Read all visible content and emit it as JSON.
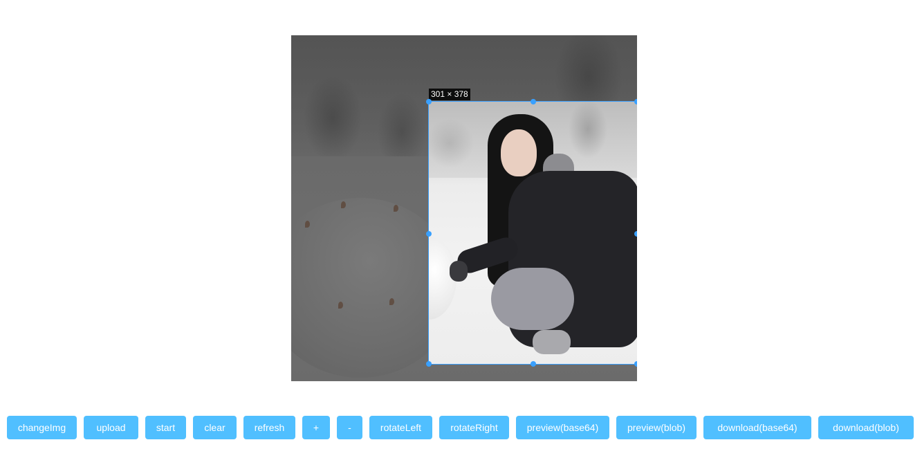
{
  "cropper": {
    "size_label": "301 × 378",
    "accent_color": "#39a0ff"
  },
  "toolbar": {
    "button_color": "#50bfff",
    "buttons": [
      {
        "label": "changeImg"
      },
      {
        "label": "upload"
      },
      {
        "label": "start"
      },
      {
        "label": "clear"
      },
      {
        "label": "refresh"
      },
      {
        "label": "+"
      },
      {
        "label": "-"
      },
      {
        "label": "rotateLeft"
      },
      {
        "label": "rotateRight"
      },
      {
        "label": "preview(base64)"
      },
      {
        "label": "preview(blob)"
      },
      {
        "label": "download(base64)"
      },
      {
        "label": "download(blob)"
      }
    ]
  }
}
